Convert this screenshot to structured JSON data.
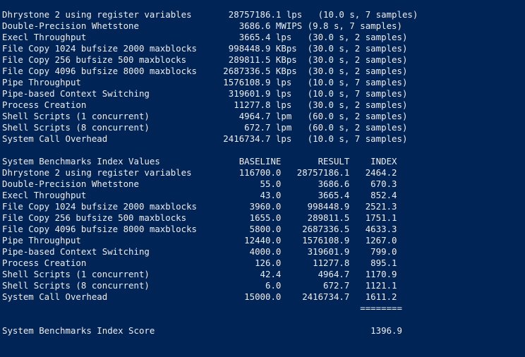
{
  "terminal": {
    "results": [
      "Dhrystone 2 using register variables       28757186.1 lps   (10.0 s, 7 samples)",
      "Double-Precision Whetstone                   3686.6 MWIPS (9.8 s, 7 samples)",
      "Execl Throughput                             3665.4 lps   (30.0 s, 2 samples)",
      "File Copy 1024 bufsize 2000 maxblocks      998448.9 KBps  (30.0 s, 2 samples)",
      "File Copy 256 bufsize 500 maxblocks        289811.5 KBps  (30.0 s, 2 samples)",
      "File Copy 4096 bufsize 8000 maxblocks     2687336.5 KBps  (30.0 s, 2 samples)",
      "Pipe Throughput                           1576108.9 lps   (10.0 s, 7 samples)",
      "Pipe-based Context Switching               319601.9 lps   (10.0 s, 7 samples)",
      "Process Creation                            11277.8 lps   (30.0 s, 2 samples)",
      "Shell Scripts (1 concurrent)                 4964.7 lpm   (60.0 s, 2 samples)",
      "Shell Scripts (8 concurrent)                  672.7 lpm   (60.0 s, 2 samples)",
      "System Call Overhead                      2416734.7 lps   (10.0 s, 7 samples)"
    ],
    "index_header": "System Benchmarks Index Values               BASELINE       RESULT    INDEX",
    "index_rows": [
      "Dhrystone 2 using register variables         116700.0   28757186.1   2464.2",
      "Double-Precision Whetstone                       55.0       3686.6    670.3",
      "Execl Throughput                                 43.0       3665.4    852.4",
      "File Copy 1024 bufsize 2000 maxblocks          3960.0     998448.9   2521.3",
      "File Copy 256 bufsize 500 maxblocks            1655.0     289811.5   1751.1",
      "File Copy 4096 bufsize 8000 maxblocks          5800.0    2687336.5   4633.3",
      "Pipe Throughput                               12440.0    1576108.9   1267.0",
      "Pipe-based Context Switching                   4000.0     319601.9    799.0",
      "Process Creation                                126.0      11277.8    895.1",
      "Shell Scripts (1 concurrent)                     42.4       4964.7   1170.9",
      "Shell Scripts (8 concurrent)                      6.0        672.7   1121.1",
      "System Call Overhead                          15000.0    2416734.7   1611.2"
    ],
    "separator": "                                                                    ========",
    "score_line": "System Benchmarks Index Score                                         1396.9"
  }
}
